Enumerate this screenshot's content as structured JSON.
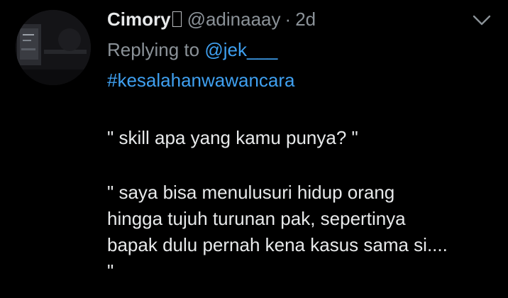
{
  "tweet": {
    "author": {
      "display_name": "Cimory",
      "handle": "@adinaaay",
      "separator": "·",
      "time": "2d",
      "avatar_icon": "profile-photo-dark"
    },
    "menu_icon": "chevron-down-icon",
    "reply": {
      "prefix": "Replying to ",
      "user": "@jek___"
    },
    "hashtag": "#kesalahanwawancara",
    "question": "\" skill apa yang kamu punya? \"",
    "answer_lines": [
      "\" saya bisa menulusuri hidup orang",
      "hingga tujuh turunan pak, sepertinya",
      "bapak dulu pernah kena kasus sama si....",
      "\""
    ]
  },
  "colors": {
    "background": "#000000",
    "text": "#e7e9ea",
    "secondary": "#8b9298",
    "link": "#3fa0f0"
  }
}
